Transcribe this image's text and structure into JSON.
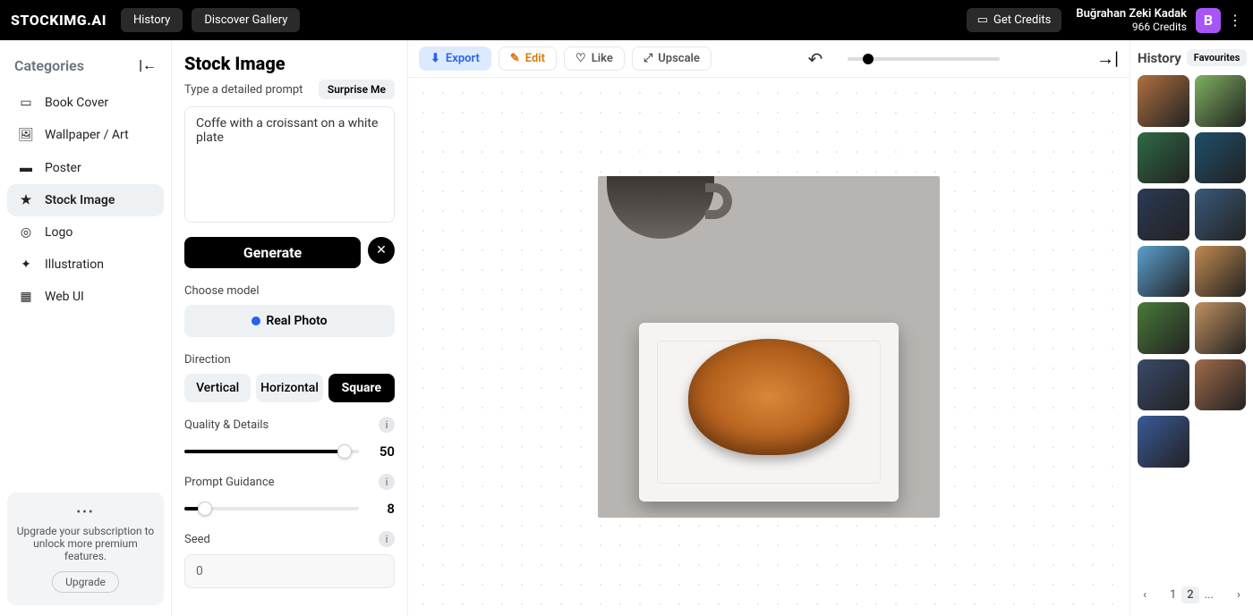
{
  "brand": "STOCKIMG.AI",
  "topbar": {
    "history": "History",
    "gallery": "Discover Gallery",
    "get_credits": "Get Credits",
    "user_name": "Buğrahan Zeki Kadak",
    "credits": "966 Credits",
    "avatar_initial": "B"
  },
  "categories": {
    "title": "Categories",
    "items": [
      {
        "icon": "▭",
        "label": "Book Cover"
      },
      {
        "icon": "🖼",
        "label": "Wallpaper / Art"
      },
      {
        "icon": "▬",
        "label": "Poster"
      },
      {
        "icon": "★",
        "label": "Stock Image",
        "active": true
      },
      {
        "icon": "◎",
        "label": "Logo"
      },
      {
        "icon": "✦",
        "label": "Illustration"
      },
      {
        "icon": "▦",
        "label": "Web UI"
      }
    ],
    "upgrade_text": "Upgrade your subscription to unlock more premium features.",
    "upgrade_btn": "Upgrade"
  },
  "controls": {
    "title": "Stock Image",
    "prompt_label": "Type a detailed prompt",
    "surprise": "Surprise Me",
    "prompt_value": "Coffe with a croissant on a white plate",
    "generate": "Generate",
    "model_label": "Choose model",
    "model_value": "Real Photo",
    "direction_label": "Direction",
    "directions": [
      "Vertical",
      "Horizontal",
      "Square"
    ],
    "direction_active": "Square",
    "quality_label": "Quality & Details",
    "quality_value": "50",
    "guidance_label": "Prompt Guidance",
    "guidance_value": "8",
    "seed_label": "Seed",
    "seed_value": "0"
  },
  "toolbar": {
    "export": "Export",
    "edit": "Edit",
    "like": "Like",
    "upscale": "Upscale"
  },
  "history_panel": {
    "title": "History",
    "favourites": "Favourites",
    "thumb_colors": [
      "#b07040",
      "#7fb060",
      "#2e6b45",
      "#1e4f6b",
      "#2b3a55",
      "#3a5a7a",
      "#5aa0d0",
      "#c08a50",
      "#4a7a3a",
      "#c09060",
      "#3a4a6a",
      "#a06a4a",
      "#3a5a9a"
    ],
    "pages": [
      "1",
      "2",
      "..."
    ],
    "active_page": "2"
  }
}
